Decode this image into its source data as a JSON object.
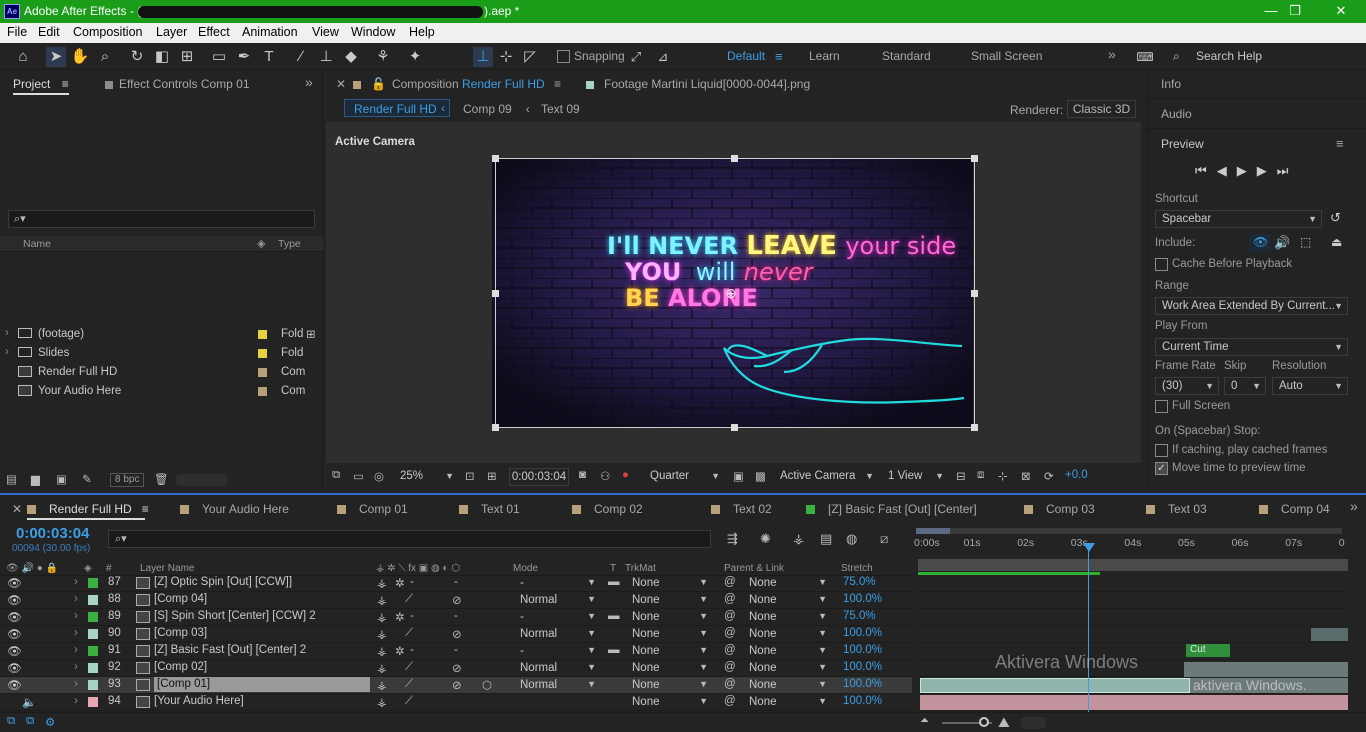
{
  "window": {
    "app_name": "Adobe After Effects",
    "title": "Adobe After Effects - (                                                            ).aep *",
    "title_visible_end": ").aep *",
    "controls": {
      "minimize": "—",
      "restore": "❐",
      "close": "✕"
    }
  },
  "menu": [
    "File",
    "Edit",
    "Composition",
    "Layer",
    "Effect",
    "Animation",
    "View",
    "Window",
    "Help"
  ],
  "toolbar": {
    "snapping_label": "Snapping",
    "workspaces": [
      "Default",
      "Learn",
      "Standard",
      "Small Screen"
    ],
    "active_workspace": "Default",
    "search_placeholder": "Search Help"
  },
  "project_panel": {
    "tab_project": "Project",
    "tab_effect_controls": "Effect Controls Comp 01",
    "search_placeholder": "",
    "col_name": "Name",
    "col_type": "Type",
    "items": [
      {
        "name": "(footage)",
        "type": "Fold",
        "kind": "folder",
        "color": "#e6d23c"
      },
      {
        "name": "Slides",
        "type": "Fold",
        "kind": "folder",
        "color": "#e6d23c"
      },
      {
        "name": "Render Full HD",
        "type": "Com",
        "kind": "comp",
        "color": "#b7a17a"
      },
      {
        "name": "Your Audio Here",
        "type": "Com",
        "kind": "comp",
        "color": "#b7a17a"
      }
    ],
    "bpc": "8 bpc"
  },
  "composition_panel": {
    "tab_prefix": "Composition",
    "tab_name": "Render Full HD",
    "footage_tab": "Footage  Martini Liquid[0000-0044].png",
    "breadcrumbs": [
      "Render Full HD",
      "Comp 09",
      "Text 09"
    ],
    "renderer_label": "Renderer:",
    "renderer_value": "Classic 3D",
    "active_camera": "Active Camera",
    "viewer_text": {
      "line1a": "I'll NEVER",
      "line1b": "LEAVE",
      "line1c": "your side",
      "line2a": "YOU",
      "line2b": "will",
      "line2c": "never",
      "line3a": "BE",
      "line3b": "ALONE"
    },
    "footer": {
      "zoom": "25%",
      "timecode": "0:00:03:04",
      "resolution": "Quarter",
      "camera": "Active Camera",
      "views": "1 View",
      "exposure": "+0.0"
    }
  },
  "right_panel": {
    "info": "Info",
    "audio": "Audio",
    "preview": "Preview",
    "shortcut_label": "Shortcut",
    "shortcut_value": "Spacebar",
    "include_label": "Include:",
    "cache_before_playback": "Cache Before Playback",
    "range_label": "Range",
    "range_value": "Work Area Extended By Current...",
    "play_from_label": "Play From",
    "play_from_value": "Current Time",
    "frame_rate_label": "Frame Rate",
    "frame_rate_value": "(30)",
    "skip_label": "Skip",
    "skip_value": "0",
    "resolution_label": "Resolution",
    "resolution_value": "Auto",
    "full_screen": "Full Screen",
    "on_stop_label": "On (Spacebar) Stop:",
    "if_caching": "If caching, play cached frames",
    "move_time": "Move time to preview time"
  },
  "timeline": {
    "tabs": [
      {
        "name": "Render Full HD",
        "color": "#b7a17a",
        "active": true
      },
      {
        "name": "Your Audio Here",
        "color": "#b7a17a"
      },
      {
        "name": "Comp 01",
        "color": "#b7a17a"
      },
      {
        "name": "Text 01",
        "color": "#b7a17a"
      },
      {
        "name": "Comp 02",
        "color": "#b7a17a"
      },
      {
        "name": "Text 02",
        "color": "#b7a17a"
      },
      {
        "name": "[Z] Basic Fast [Out] [Center]",
        "color": "#3cb043"
      },
      {
        "name": "Comp 03",
        "color": "#b7a17a"
      },
      {
        "name": "Text 03",
        "color": "#b7a17a"
      },
      {
        "name": "Comp 04",
        "color": "#b7a17a"
      }
    ],
    "current_time": "0:00:03:04",
    "frame_info": "00094 (30.00 fps)",
    "columns": {
      "hash": "#",
      "layer_name": "Layer Name",
      "mode": "Mode",
      "t": "T",
      "trkmat": "TrkMat",
      "parent": "Parent & Link",
      "stretch": "Stretch"
    },
    "ruler": [
      "0:00s",
      "01s",
      "02s",
      "03s",
      "04s",
      "05s",
      "06s",
      "07s",
      "0"
    ],
    "layers": [
      {
        "num": "87",
        "name": "[Z] Optic Spin [Out] [CCW]]",
        "mode": "-",
        "trkmat": "None",
        "parent": "None",
        "stretch": "75.0%",
        "color": "#3cb043"
      },
      {
        "num": "88",
        "name": "[Comp 04]",
        "mode": "Normal",
        "trkmat": "None",
        "parent": "None",
        "stretch": "100.0%",
        "color": "#a8d4c8"
      },
      {
        "num": "89",
        "name": "[S] Spin Short [Center] [CCW] 2",
        "mode": "-",
        "trkmat": "None",
        "parent": "None",
        "stretch": "75.0%",
        "color": "#3cb043"
      },
      {
        "num": "90",
        "name": "[Comp 03]",
        "mode": "Normal",
        "trkmat": "None",
        "parent": "None",
        "stretch": "100.0%",
        "color": "#a8d4c8"
      },
      {
        "num": "91",
        "name": "[Z] Basic Fast [Out] [Center] 2",
        "mode": "-",
        "trkmat": "None",
        "parent": "None",
        "stretch": "100.0%",
        "color": "#3cb043"
      },
      {
        "num": "92",
        "name": "[Comp 02]",
        "mode": "Normal",
        "trkmat": "None",
        "parent": "None",
        "stretch": "100.0%",
        "color": "#a8d4c8"
      },
      {
        "num": "93",
        "name": "[Comp 01]",
        "mode": "Normal",
        "trkmat": "None",
        "parent": "None",
        "stretch": "100.0%",
        "color": "#a8d4c8",
        "selected": true
      },
      {
        "num": "94",
        "name": "[Your Audio Here]",
        "mode": "",
        "trkmat": "None",
        "parent": "None",
        "stretch": "100.0%",
        "color": "#e8a6b4"
      }
    ],
    "cut_label": "Cut",
    "watermark1": "Aktivera Windows",
    "watermark2": "aktivera Windows."
  }
}
